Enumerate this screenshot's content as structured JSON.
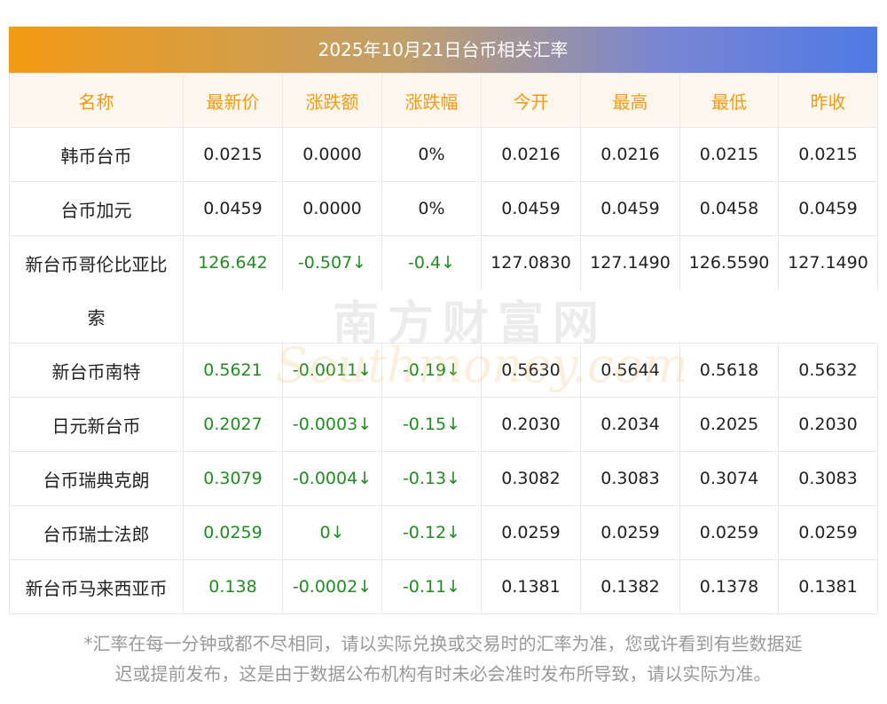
{
  "title": "2025年10月21日台币相关汇率",
  "headers": [
    "名称",
    "最新价",
    "涨跌额",
    "涨跌幅",
    "今开",
    "最高",
    "最低",
    "昨收"
  ],
  "rows": [
    {
      "name": "韩币台币",
      "latest": "0.0215",
      "change": "0.0000",
      "pct": "0%",
      "open": "0.0216",
      "high": "0.0216",
      "low": "0.0215",
      "prev": "0.0215"
    },
    {
      "name": "台币加元",
      "latest": "0.0459",
      "change": "0.0000",
      "pct": "0%",
      "open": "0.0459",
      "high": "0.0459",
      "low": "0.0458",
      "prev": "0.0459"
    },
    {
      "name": "新台币哥伦比亚比",
      "name_cont": "索",
      "latest": "126.642",
      "change": "-0.507↓",
      "pct": "-0.4↓",
      "open": "127.0830",
      "high": "127.1490",
      "low": "126.5590",
      "prev": "127.1490"
    },
    {
      "name": "新台币南特",
      "latest": "0.5621",
      "change": "-0.0011↓",
      "pct": "-0.19↓",
      "open": "0.5630",
      "high": "0.5644",
      "low": "0.5618",
      "prev": "0.5632"
    },
    {
      "name": "日元新台币",
      "latest": "0.2027",
      "change": "-0.0003↓",
      "pct": "-0.15↓",
      "open": "0.2030",
      "high": "0.2034",
      "low": "0.2025",
      "prev": "0.2030"
    },
    {
      "name": "台币瑞典克朗",
      "latest": "0.3079",
      "change": "-0.0004↓",
      "pct": "-0.13↓",
      "open": "0.3082",
      "high": "0.3083",
      "low": "0.3074",
      "prev": "0.3083"
    },
    {
      "name": "台币瑞士法郎",
      "latest": "0.0259",
      "change": "0↓",
      "pct": "-0.12↓",
      "open": "0.0259",
      "high": "0.0259",
      "low": "0.0259",
      "prev": "0.0259"
    },
    {
      "name": "新台币马来西亚币",
      "latest": "0.138",
      "change": "-0.0002↓",
      "pct": "-0.11↓",
      "open": "0.1381",
      "high": "0.1382",
      "low": "0.1378",
      "prev": "0.1381"
    }
  ],
  "watermark": {
    "cn": "南方财富网",
    "en": "Southmoney.com"
  },
  "note_line1": "*汇率在每一分钟或都不尽相同，请以实际兑换或交易时的汇率为准，您或许看到有些数据延",
  "note_line2": "迟或提前发布，这是由于数据公布机构有时未必会准时发布所导致，请以实际为准。",
  "colors": {
    "accent": "#f39a12",
    "down": "#1e8f1e",
    "header_bg": "#fdf7ef",
    "title_from": "#f39a12",
    "title_to": "#4f79e6"
  }
}
